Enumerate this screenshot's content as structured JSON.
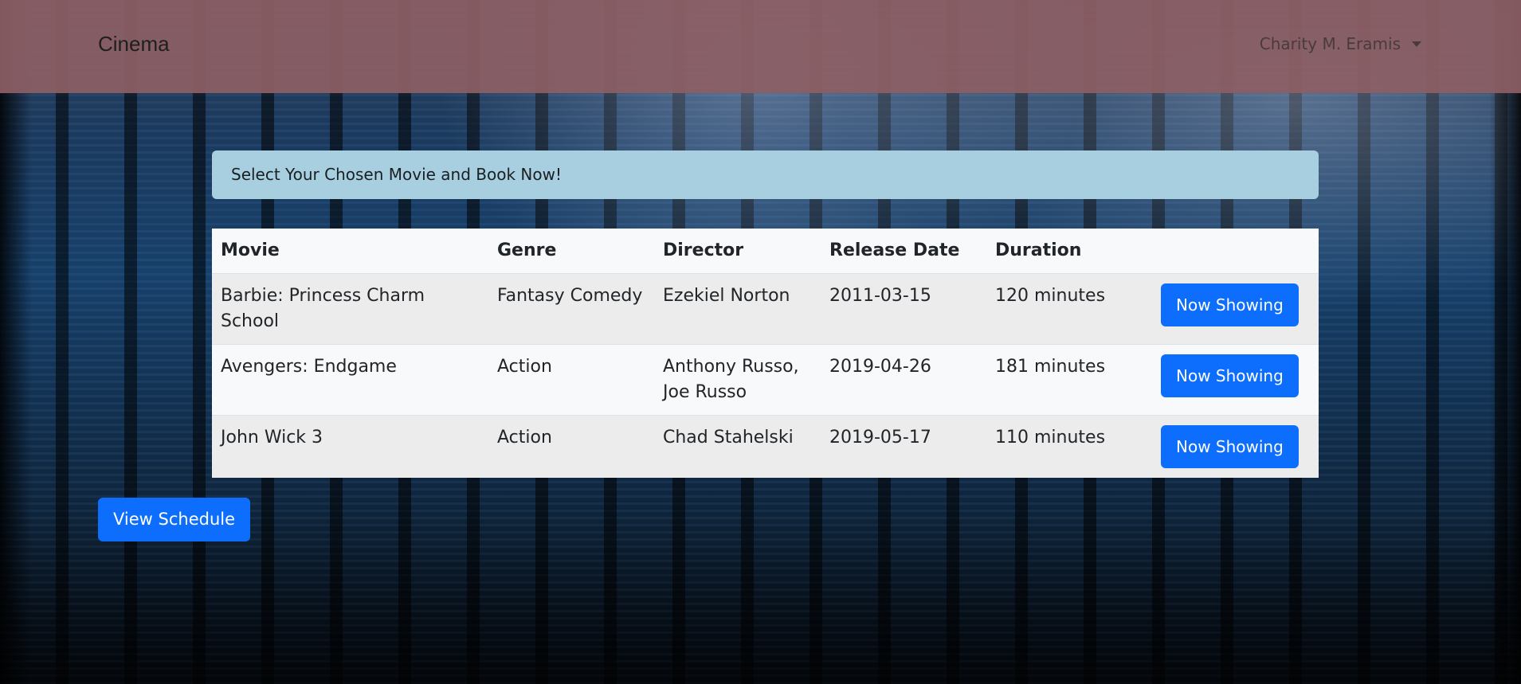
{
  "navbar": {
    "brand": "Cinema",
    "user_name": "Charity M. Eramis"
  },
  "alert": {
    "message": "Select Your Chosen Movie and Book Now!"
  },
  "table": {
    "headers": {
      "movie": "Movie",
      "genre": "Genre",
      "director": "Director",
      "release_date": "Release Date",
      "duration": "Duration"
    },
    "rows": [
      {
        "movie": "Barbie: Princess Charm School",
        "genre": "Fantasy Comedy",
        "director": "Ezekiel Norton",
        "release_date": "2011-03-15",
        "duration": "120 minutes",
        "action": "Now Showing"
      },
      {
        "movie": "Avengers: Endgame",
        "genre": "Action",
        "director": "Anthony Russo, Joe Russo",
        "release_date": "2019-04-26",
        "duration": "181 minutes",
        "action": "Now Showing"
      },
      {
        "movie": "John Wick 3",
        "genre": "Action",
        "director": "Chad Stahelski",
        "release_date": "2019-05-17",
        "duration": "110 minutes",
        "action": "Now Showing"
      }
    ]
  },
  "schedule_button": "View Schedule",
  "colors": {
    "navbar_bg": "#8c5f64",
    "alert_bg": "#a8cfe0",
    "primary_button": "#0d6efd"
  },
  "icons": {
    "user_menu": "caret-down-icon"
  }
}
